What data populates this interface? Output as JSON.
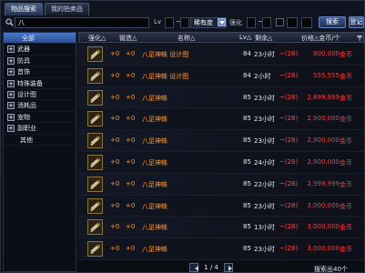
{
  "tabs": [
    {
      "label": "物品搜索",
      "active": true
    },
    {
      "label": "我的拍卖品",
      "active": false
    }
  ],
  "search": {
    "value": "八",
    "level_label": "Lv",
    "rarity_value": "稀有度",
    "enhance_label": "强化",
    "tilde": "~",
    "search_button": "搜索",
    "register_button": "登记"
  },
  "sidebar": {
    "items": [
      {
        "label": "全部",
        "expandable": false
      },
      {
        "label": "武器",
        "expandable": true
      },
      {
        "label": "防具",
        "expandable": true
      },
      {
        "label": "首饰",
        "expandable": true
      },
      {
        "label": "特殊装备",
        "expandable": true
      },
      {
        "label": "设计图",
        "expandable": true
      },
      {
        "label": "消耗品",
        "expandable": true
      },
      {
        "label": "宠物",
        "expandable": true
      },
      {
        "label": "副职业",
        "expandable": true
      },
      {
        "label": "其他",
        "expandable": false
      }
    ]
  },
  "table": {
    "headers": {
      "enhance": "强化△",
      "refine": "锻造△",
      "name": "名称△",
      "lv": "Lv△",
      "time": "剩余△",
      "price": "价格△金币/个",
      "pin": "╤"
    },
    "rows": [
      {
        "enh": "+0",
        "ref": "+0",
        "name": "八足神蛛 设计图",
        "lv": "84",
        "time": "23小时",
        "sale": "~(28)",
        "price": "800,000",
        "unit": "金币"
      },
      {
        "enh": "+0",
        "ref": "+0",
        "name": "八足神蛛 设计图",
        "lv": "84",
        "time": "2小时",
        "sale": "~(28)",
        "price": "555,555",
        "unit": "金币"
      },
      {
        "enh": "+0",
        "ref": "+0",
        "name": "八足神蛛",
        "lv": "85",
        "time": "23小时",
        "sale": "~(28)",
        "price": "2,899,999",
        "unit": "金币"
      },
      {
        "enh": "+0",
        "ref": "+0",
        "name": "八足神蛛",
        "lv": "85",
        "time": "23小时",
        "sale": "~(28)",
        "price": "2,900,000",
        "unit": "金币"
      },
      {
        "enh": "+0",
        "ref": "+0",
        "name": "八足神蛛",
        "lv": "85",
        "time": "23小时",
        "sale": "~(28)",
        "price": "2,900,000",
        "unit": "金币"
      },
      {
        "enh": "+0",
        "ref": "+0",
        "name": "八足神蛛",
        "lv": "85",
        "time": "24小时",
        "sale": "~(28)",
        "price": "2,900,000",
        "unit": "金币"
      },
      {
        "enh": "+0",
        "ref": "+0",
        "name": "八足神蛛",
        "lv": "85",
        "time": "22小时",
        "sale": "~(28)",
        "price": "2,999,999",
        "unit": "金币"
      },
      {
        "enh": "+0",
        "ref": "+0",
        "name": "八足神蛛",
        "lv": "85",
        "time": "23小时",
        "sale": "~(28)",
        "price": "3,000,000",
        "unit": "金币"
      },
      {
        "enh": "+0",
        "ref": "+0",
        "name": "八足神蛛",
        "lv": "85",
        "time": "13小时",
        "sale": "~(28)",
        "price": "3,000,000",
        "unit": "金币"
      },
      {
        "enh": "+0",
        "ref": "+0",
        "name": "八足神蛛",
        "lv": "85",
        "time": "23小时",
        "sale": "~(28)",
        "price": "3,000,000",
        "unit": "金币"
      }
    ]
  },
  "pager": {
    "text": "1 / 4"
  },
  "result_text": "搜索出40个",
  "icons": {
    "search": "magnifier-icon",
    "item": "spider-item-icon"
  },
  "colors": {
    "accent": "#4a78c8",
    "price": "#ff3a3a",
    "item_name": "#ff9a3a"
  }
}
